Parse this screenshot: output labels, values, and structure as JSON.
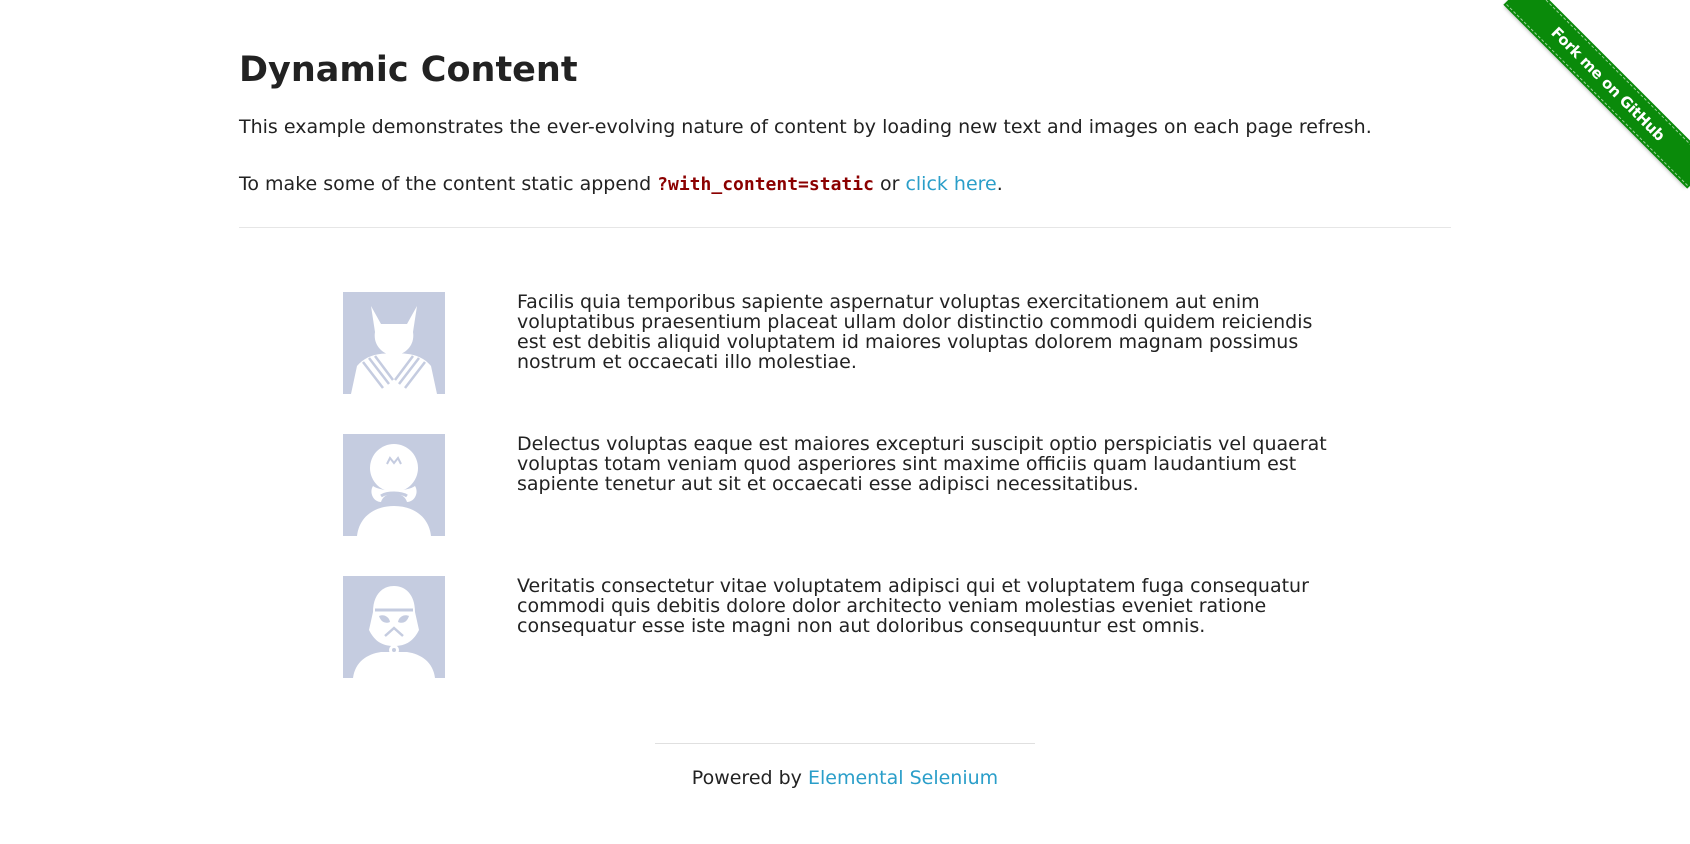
{
  "ribbon": {
    "label": "Fork me on GitHub",
    "color": "#0a8a0a"
  },
  "header": {
    "title": "Dynamic Content"
  },
  "intro": {
    "text": "This example demonstrates the ever-evolving nature of content by loading new text and images on each page refresh."
  },
  "static_note": {
    "prefix": "To make some of the content static append ",
    "code": "?with_content=static",
    "middle": " or ",
    "link": "click here",
    "suffix": "."
  },
  "rows": [
    {
      "icon": "wolverine-avatar-icon",
      "text": "Facilis quia temporibus sapiente aspernatur voluptas exercitationem aut enim voluptatibus praesentium placeat ullam dolor distinctio commodi quidem reiciendis est est debitis aliquid voluptatem id maiores voluptas dolorem magnam possimus nostrum et occaecati illo molestiae."
    },
    {
      "icon": "mario-avatar-icon",
      "text": "Delectus voluptas eaque est maiores excepturi suscipit optio perspiciatis vel quaerat voluptas totam veniam quod asperiores sint maxime officiis quam laudantium est sapiente tenetur aut sit et occaecati esse adipisci necessitatibus."
    },
    {
      "icon": "stormtrooper-avatar-icon",
      "text": "Veritatis consectetur vitae voluptatem adipisci qui et voluptatem fuga consequatur commodi quis debitis dolore dolor architecto veniam molestias eveniet ratione consequatur esse iste magni non aut doloribus consequuntur est omnis."
    }
  ],
  "footer": {
    "prefix": "Powered by ",
    "link": "Elemental Selenium"
  },
  "colors": {
    "link": "#2a9ec9",
    "code": "#8b0000",
    "avatar_bg": "#c5cce0"
  }
}
